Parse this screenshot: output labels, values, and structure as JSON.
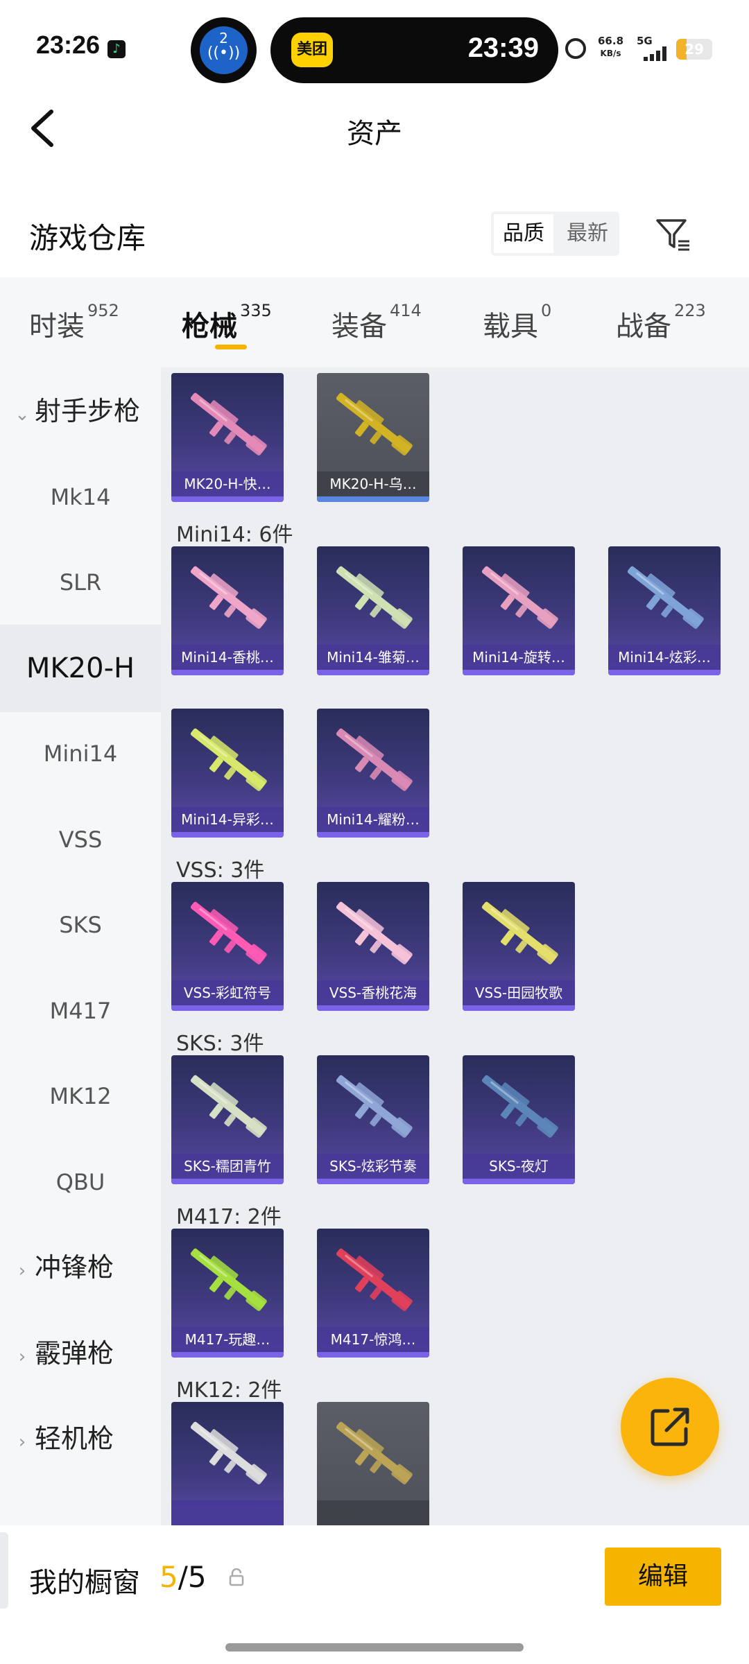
{
  "status_bar": {
    "time": "23:26",
    "island_badge": "2",
    "island_app": "美团",
    "island_time": "23:39",
    "net_speed": "66.8",
    "net_unit": "KB/s",
    "network": "5G",
    "battery": "29",
    "battery_level": 0.29
  },
  "header": {
    "title": "资产"
  },
  "warehouse": {
    "title": "游戏仓库",
    "sort_options": [
      "品质",
      "最新"
    ]
  },
  "tabs": [
    {
      "label": "时装",
      "count": "952"
    },
    {
      "label": "枪械",
      "count": "335",
      "active": true
    },
    {
      "label": "装备",
      "count": "414"
    },
    {
      "label": "载具",
      "count": "0"
    },
    {
      "label": "战备",
      "count": "223"
    }
  ],
  "sidebar": [
    {
      "label": "射手步枪",
      "type": "group",
      "expanded": true
    },
    {
      "label": "Mk14"
    },
    {
      "label": "SLR"
    },
    {
      "label": "MK20-H",
      "active": true
    },
    {
      "label": "Mini14"
    },
    {
      "label": "VSS"
    },
    {
      "label": "SKS"
    },
    {
      "label": "M417"
    },
    {
      "label": "MK12"
    },
    {
      "label": "QBU"
    },
    {
      "label": "冲锋枪",
      "type": "group"
    },
    {
      "label": "霰弹枪",
      "type": "group"
    },
    {
      "label": "轻机枪",
      "type": "group"
    }
  ],
  "sections": [
    {
      "label": "",
      "items": [
        {
          "name": "MK20-H-快…",
          "gun": "#e48ab8"
        },
        {
          "name": "MK20-H-乌…",
          "gun": "#d1b323",
          "style": "grey"
        }
      ]
    },
    {
      "label": "Mini14: 6件",
      "items": [
        {
          "name": "Mini14-香桃…",
          "gun": "#f0a6c8"
        },
        {
          "name": "Mini14-雏菊…",
          "gun": "#cfe0b2"
        },
        {
          "name": "Mini14-旋转…",
          "gun": "#e8a0c0"
        },
        {
          "name": "Mini14-炫彩…",
          "gun": "#7fa4d8"
        },
        {
          "name": "Mini14-异彩…",
          "gun": "#d7e86a"
        },
        {
          "name": "Mini14-耀粉…",
          "gun": "#d98ab4"
        }
      ]
    },
    {
      "label": "VSS: 3件",
      "items": [
        {
          "name": "VSS-彩虹符号",
          "gun": "#ff5ab4"
        },
        {
          "name": "VSS-香桃花海",
          "gun": "#f5c2d8"
        },
        {
          "name": "VSS-田园牧歌",
          "gun": "#e4de6a"
        }
      ]
    },
    {
      "label": "SKS: 3件",
      "items": [
        {
          "name": "SKS-糯团青竹",
          "gun": "#d6e0c4"
        },
        {
          "name": "SKS-炫彩节奏",
          "gun": "#8fa6d6"
        },
        {
          "name": "SKS-夜灯",
          "gun": "#5c86b8"
        }
      ]
    },
    {
      "label": "M417: 2件",
      "items": [
        {
          "name": "M417-玩趣…",
          "gun": "#a6e040"
        },
        {
          "name": "M417-惊鸿…",
          "gun": "#e0405a"
        }
      ]
    },
    {
      "label": "MK12: 2件",
      "items": [
        {
          "name": "",
          "gun": "#dddddd"
        },
        {
          "name": "",
          "gun": "#bba455",
          "style": "grey"
        }
      ]
    }
  ],
  "bottom_bar": {
    "title": "我的橱窗",
    "used": "5",
    "separator": "/",
    "total": "5",
    "edit_label": "编辑"
  },
  "colors": {
    "accent": "#f5b400",
    "card_top": "#2a2d5a",
    "card_bottom": "#5a4aa8",
    "sidebar_bg": "#f6f7f9",
    "content_bg": "#eceef2"
  }
}
